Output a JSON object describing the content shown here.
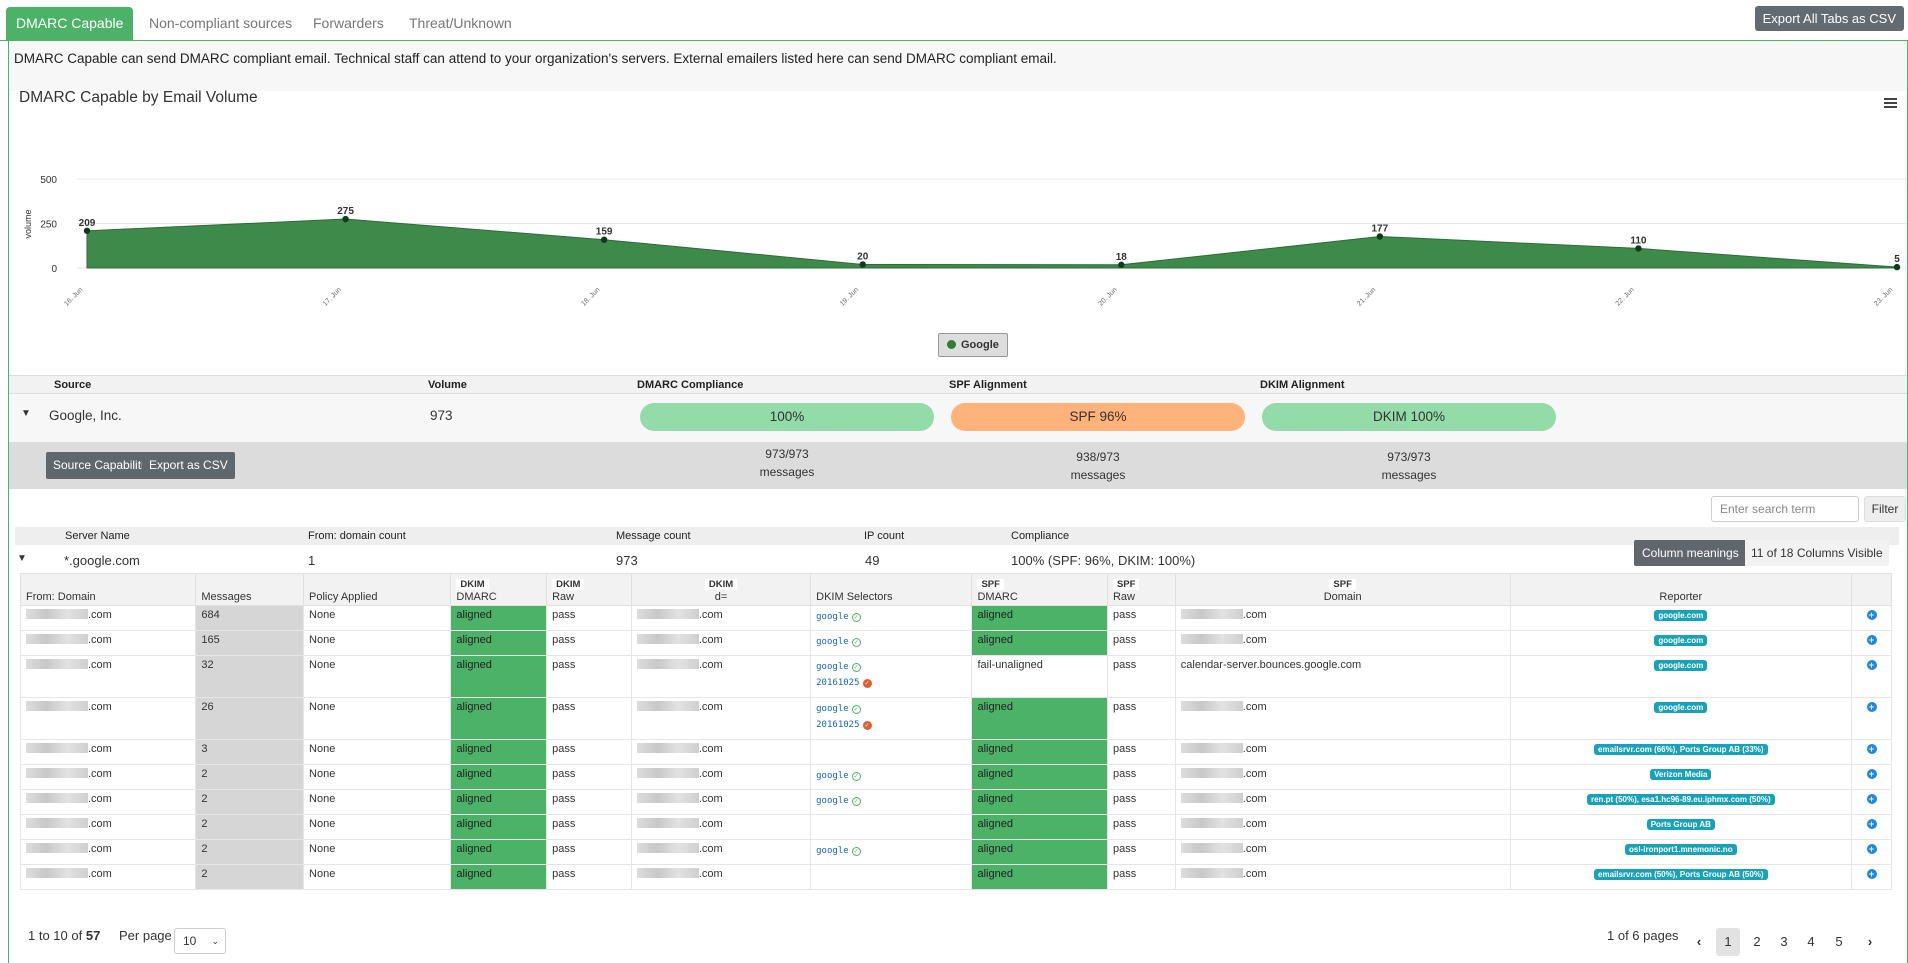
{
  "tabs": [
    "DMARC Capable",
    "Non-compliant sources",
    "Forwarders",
    "Threat/Unknown"
  ],
  "export_all": "Export All Tabs as CSV",
  "description": "DMARC Capable can send DMARC compliant email. Technical staff can attend to your organization's servers. External emailers listed here can send DMARC compliant email.",
  "chart_data": {
    "type": "area",
    "title": "DMARC Capable by Email Volume",
    "ylabel": "volume",
    "ylim": [
      0,
      500
    ],
    "yticks": [
      "500",
      "250",
      "0"
    ],
    "categories": [
      "16. Jun",
      "17. Jun",
      "18. Jun",
      "19. Jun",
      "20. Jun",
      "21. Jun",
      "22. Jun",
      "23. Jun"
    ],
    "series": [
      {
        "name": "Google",
        "values": [
          209,
          275,
          159,
          20,
          18,
          177,
          110,
          5
        ],
        "color": "#3d8a4a"
      }
    ]
  },
  "source_table": {
    "headers": [
      "Source",
      "Volume",
      "DMARC Compliance",
      "SPF Alignment",
      "DKIM Alignment"
    ],
    "row": {
      "source": "Google, Inc.",
      "volume": "973",
      "dmarc": "100%",
      "spf": "SPF 96%",
      "dkim": "DKIM 100%"
    },
    "dmarc_msgs": [
      "973/973",
      "messages"
    ],
    "spf_msgs": [
      "938/973",
      "messages"
    ],
    "dkim_msgs": [
      "973/973",
      "messages"
    ],
    "btn_capabilities": "Source Capabilities",
    "btn_export": "Export as CSV",
    "colors": {
      "dmarc": "#93dba8",
      "spf": "#ffb27a",
      "dkim": "#93dba8"
    }
  },
  "search": {
    "placeholder": "Enter search term",
    "filter": "Filter"
  },
  "server_table": {
    "headers": [
      "Server Name",
      "From: domain count",
      "Message count",
      "IP count",
      "Compliance"
    ],
    "row": {
      "name": "*.google.com",
      "domains": "1",
      "messages": "973",
      "ips": "49",
      "compliance": "100% (SPF: 96%, DKIM: 100%)"
    }
  },
  "column_meanings": "Column meanings",
  "columns_visible": "11 of 18 Columns Visible",
  "detail": {
    "headers": [
      {
        "top": "",
        "label": "From: Domain"
      },
      {
        "top": "",
        "label": "Messages"
      },
      {
        "top": "",
        "label": "Policy Applied"
      },
      {
        "top": "DKIM",
        "label": "DMARC"
      },
      {
        "top": "DKIM",
        "label": "Raw"
      },
      {
        "top": "DKIM",
        "label": "d="
      },
      {
        "top": "",
        "label": "DKIM Selectors"
      },
      {
        "top": "SPF",
        "label": "DMARC"
      },
      {
        "top": "SPF",
        "label": "Raw"
      },
      {
        "top": "SPF",
        "label": "Domain"
      },
      {
        "top": "",
        "label": "Reporter"
      }
    ],
    "rows": [
      {
        "msgs": "684",
        "policy": "None",
        "dkim": "aligned",
        "raw": "pass",
        "sel": [
          [
            "google",
            "ok"
          ]
        ],
        "spf": "aligned",
        "spfraw": "pass",
        "spfdom": ".com",
        "rep": "google.com"
      },
      {
        "msgs": "165",
        "policy": "None",
        "dkim": "aligned",
        "raw": "pass",
        "sel": [
          [
            "google",
            "ok"
          ]
        ],
        "spf": "aligned",
        "spfraw": "pass",
        "spfdom": ".com",
        "rep": "google.com"
      },
      {
        "msgs": "32",
        "policy": "None",
        "dkim": "aligned",
        "raw": "pass",
        "sel": [
          [
            "google",
            "ok"
          ],
          [
            "20161025",
            "bad"
          ]
        ],
        "spf": "fail-unaligned",
        "spfraw": "pass",
        "spfdom": "calendar-server.bounces.google.com",
        "rep": "google.com"
      },
      {
        "msgs": "26",
        "policy": "None",
        "dkim": "aligned",
        "raw": "pass",
        "sel": [
          [
            "google",
            "ok"
          ],
          [
            "20161025",
            "bad"
          ]
        ],
        "spf": "aligned",
        "spfraw": "pass",
        "spfdom": ".com",
        "rep": "google.com"
      },
      {
        "msgs": "3",
        "policy": "None",
        "dkim": "aligned",
        "raw": "pass",
        "sel": [],
        "spf": "aligned",
        "spfraw": "pass",
        "spfdom": ".com",
        "rep": "emailsrvr.com (66%), Ports Group AB (33%)"
      },
      {
        "msgs": "2",
        "policy": "None",
        "dkim": "aligned",
        "raw": "pass",
        "sel": [
          [
            "google",
            "ok"
          ]
        ],
        "spf": "aligned",
        "spfraw": "pass",
        "spfdom": ".com",
        "rep": "Verizon Media"
      },
      {
        "msgs": "2",
        "policy": "None",
        "dkim": "aligned",
        "raw": "pass",
        "sel": [
          [
            "google",
            "ok"
          ]
        ],
        "spf": "aligned",
        "spfraw": "pass",
        "spfdom": ".com",
        "rep": "ren.pt (50%), esa1.hc96-89.eu.iphmx.com (50%)"
      },
      {
        "msgs": "2",
        "policy": "None",
        "dkim": "aligned",
        "raw": "pass",
        "sel": [],
        "spf": "aligned",
        "spfraw": "pass",
        "spfdom": ".com",
        "rep": "Ports Group AB"
      },
      {
        "msgs": "2",
        "policy": "None",
        "dkim": "aligned",
        "raw": "pass",
        "sel": [
          [
            "google",
            "ok"
          ]
        ],
        "spf": "aligned",
        "spfraw": "pass",
        "spfdom": ".com",
        "rep": "osl-ironport1.mnemonic.no"
      },
      {
        "msgs": "2",
        "policy": "None",
        "dkim": "aligned",
        "raw": "pass",
        "sel": [],
        "spf": "aligned",
        "spfraw": "pass",
        "spfdom": ".com",
        "rep": "emailsrvr.com (50%), Ports Group AB (50%)"
      }
    ],
    "domain_suffix": ".com"
  },
  "pagination": {
    "range_prefix": "1 to 10 of",
    "total": "57",
    "per_page_label": "Per page",
    "per_page": "10",
    "pages_text": "1 of 6 pages",
    "pages": [
      "1",
      "2",
      "3",
      "4",
      "5"
    ]
  }
}
